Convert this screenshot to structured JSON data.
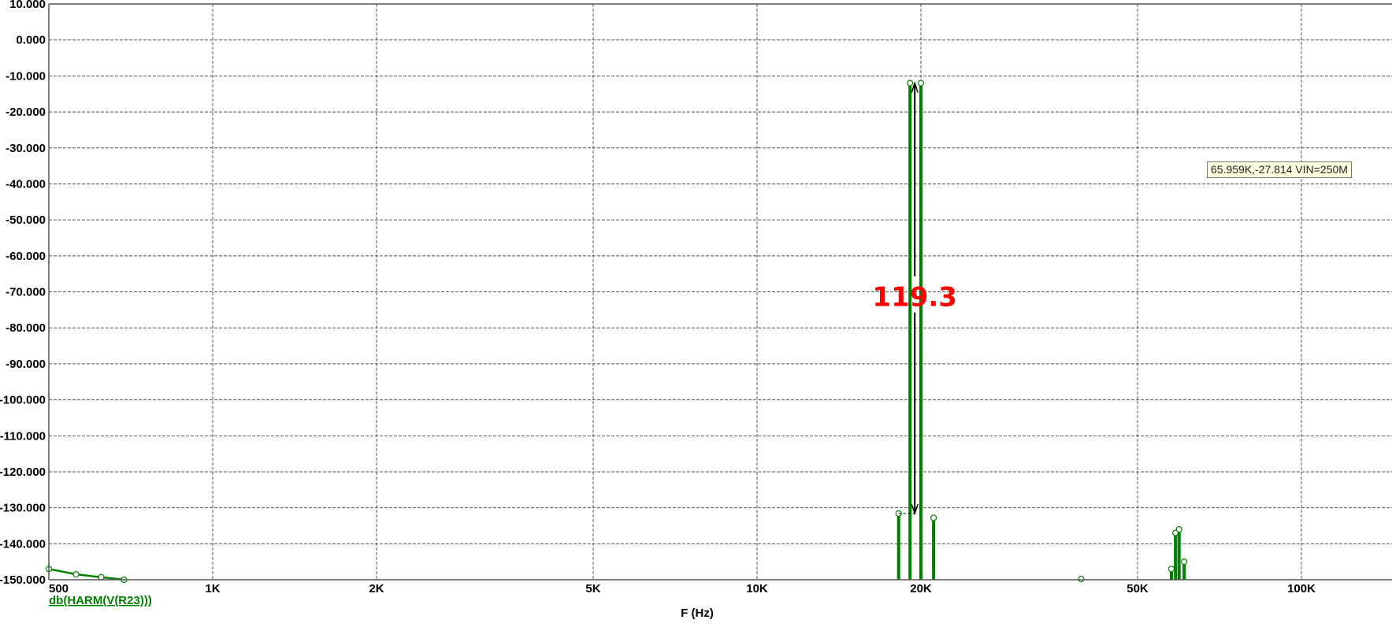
{
  "chart_data": {
    "type": "line",
    "title": "",
    "xlabel": "F (Hz)",
    "ylabel": "",
    "xscale": "log",
    "xlim": [
      500,
      146000
    ],
    "ylim": [
      -150,
      10
    ],
    "grid": true,
    "x_ticks": [
      {
        "value": 500,
        "label": "500"
      },
      {
        "value": 1000,
        "label": "1K"
      },
      {
        "value": 2000,
        "label": "2K"
      },
      {
        "value": 5000,
        "label": "5K"
      },
      {
        "value": 10000,
        "label": "10K"
      },
      {
        "value": 20000,
        "label": "20K"
      },
      {
        "value": 50000,
        "label": "50K"
      },
      {
        "value": 100000,
        "label": "100K"
      }
    ],
    "y_ticks": [
      {
        "value": 10,
        "label": "10.000"
      },
      {
        "value": 0,
        "label": "0.000"
      },
      {
        "value": -10,
        "label": "-10.000"
      },
      {
        "value": -20,
        "label": "-20.000"
      },
      {
        "value": -30,
        "label": "-30.000"
      },
      {
        "value": -40,
        "label": "-40.000"
      },
      {
        "value": -50,
        "label": "-50.000"
      },
      {
        "value": -60,
        "label": "-60.000"
      },
      {
        "value": -70,
        "label": "-70.000"
      },
      {
        "value": -80,
        "label": "-80.000"
      },
      {
        "value": -90,
        "label": "-90.000"
      },
      {
        "value": -100,
        "label": "-100.000"
      },
      {
        "value": -110,
        "label": "-110.000"
      },
      {
        "value": -120,
        "label": "-120.000"
      },
      {
        "value": -130,
        "label": "-130.000"
      },
      {
        "value": -140,
        "label": "-140.000"
      },
      {
        "value": -150,
        "label": "-150.000"
      }
    ],
    "series": [
      {
        "name": "db(HARM(V(R23)))",
        "color": "#008000",
        "curve": {
          "x": [
            500,
            561,
            624,
            687
          ],
          "y": [
            -147,
            -148.5,
            -149.3,
            -150
          ]
        },
        "stems": {
          "x": [
            18200,
            19100,
            20000,
            21100,
            39400,
            57700,
            58700,
            59600,
            60900
          ],
          "y": [
            -131.6,
            -12,
            -12,
            -132.8,
            -149.8,
            -147,
            -137,
            -136,
            -145
          ]
        }
      }
    ],
    "annotations": [
      {
        "type": "dimension-arrow",
        "x": 19550,
        "y_from": -12,
        "y_to": -131.6,
        "label": "119.3",
        "label_color": "#ff0000"
      }
    ],
    "tooltip": "65.959K,-27.814 VIN=250M"
  }
}
